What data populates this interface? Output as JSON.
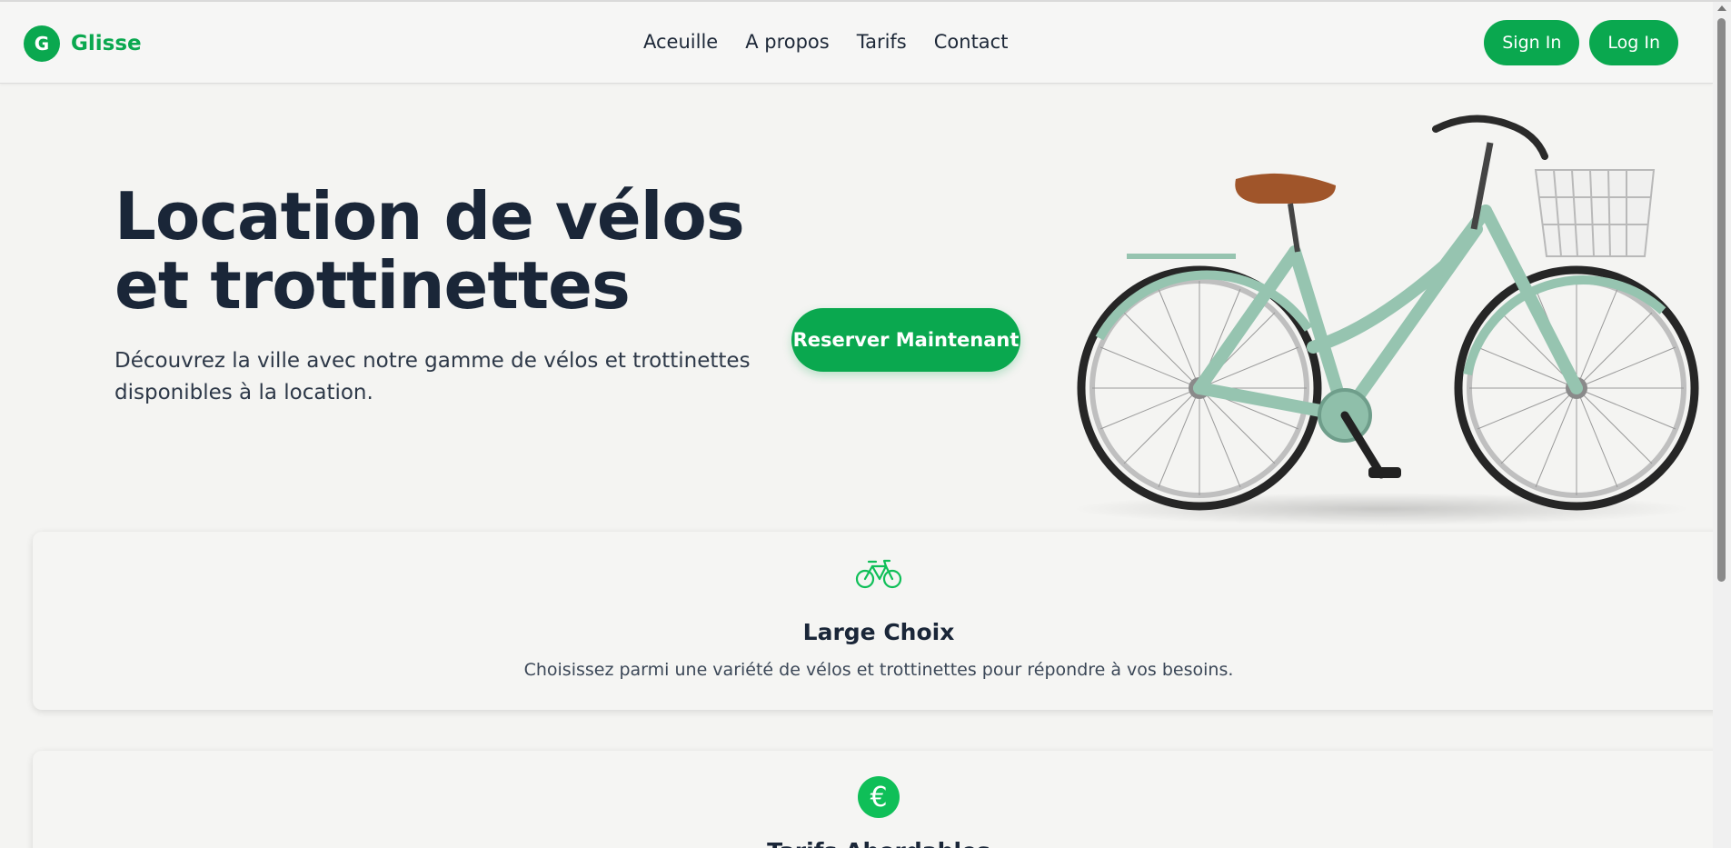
{
  "brand": {
    "initial": "G",
    "name": "Glisse",
    "color": "#0aa84f"
  },
  "nav": {
    "items": [
      "Aceuille",
      "A propos",
      "Tarifs",
      "Contact"
    ]
  },
  "auth": {
    "signin_label": "Sign In",
    "login_label": "Log In"
  },
  "hero": {
    "title_line1": "Location de vélos",
    "title_line2": "et trottinettes",
    "subtitle_line1": "Découvrez la ville avec notre gamme de vélos et trottinettes",
    "subtitle_line2": "disponibles à la location.",
    "cta_label": "Reserver Maintenant"
  },
  "features": [
    {
      "icon": "bicycle-icon",
      "title": "Large Choix",
      "description": "Choisissez parmi une variété de vélos et trottinettes pour répondre à vos besoins."
    },
    {
      "icon": "euro-icon",
      "symbol": "€",
      "title": "Tarifs Abordables"
    }
  ]
}
